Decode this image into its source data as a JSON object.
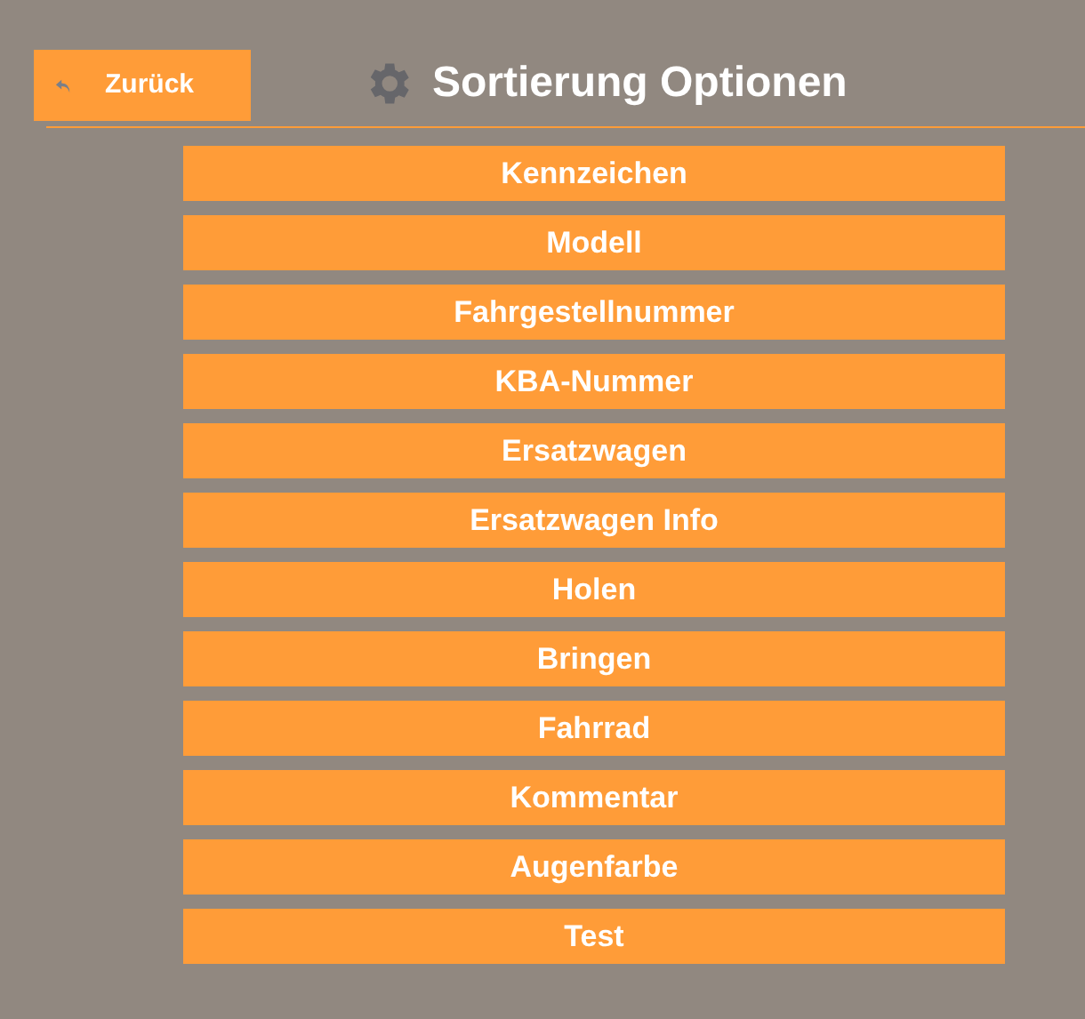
{
  "back_button": {
    "label": "Zurück"
  },
  "title": "Sortierung Optionen",
  "options": [
    {
      "label": "Kennzeichen"
    },
    {
      "label": "Modell"
    },
    {
      "label": "Fahrgestellnummer"
    },
    {
      "label": "KBA-Nummer"
    },
    {
      "label": "Ersatzwagen"
    },
    {
      "label": "Ersatzwagen Info"
    },
    {
      "label": "Holen"
    },
    {
      "label": "Bringen"
    },
    {
      "label": "Fahrrad"
    },
    {
      "label": "Kommentar"
    },
    {
      "label": "Augenfarbe"
    },
    {
      "label": "Test"
    }
  ]
}
